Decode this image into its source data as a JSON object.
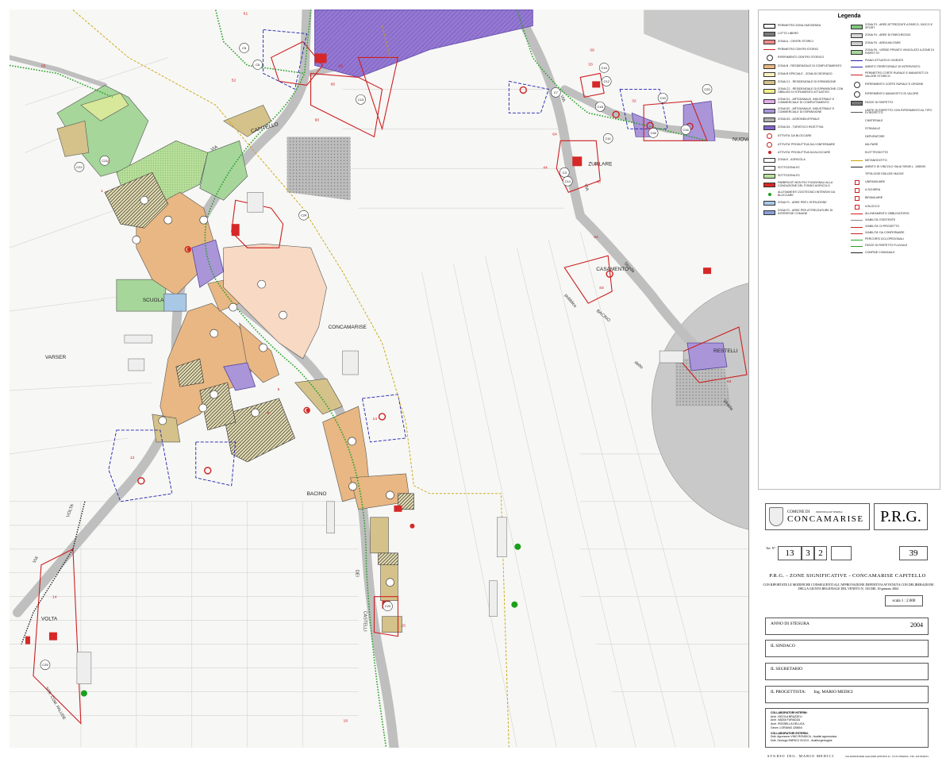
{
  "map": {
    "place_labels": [
      "CAPITELLO",
      "SCUOLA",
      "CONCAMARISE",
      "VARSER",
      "BACINO",
      "VOLTA",
      "ZURLARE",
      "CASAMENTO",
      "NUOVA",
      "RESTELLI"
    ],
    "road_labels": [
      "VIA",
      "VOLTA",
      "VIA",
      "STR. COM. PALUDE",
      "VIA",
      "DEI",
      "CASTELLI",
      "BACINO",
      "Strada",
      "pubblico",
      "detto",
      "Strada",
      "VIA"
    ],
    "zone_numbers": [
      "65",
      "61",
      "52",
      "80",
      "90",
      "85",
      "39",
      "33",
      "32",
      "64",
      "44",
      "65",
      "46",
      "84",
      "83",
      "64",
      "1",
      "2",
      "12",
      "14",
      "14",
      "15",
      "16",
      "5",
      "9"
    ],
    "circle_labels": [
      "C13",
      "C15",
      "C5",
      "C22",
      "C21",
      "C24",
      "C10",
      "C12",
      "C19",
      "C3",
      "C7",
      "C11",
      "C14",
      "C16",
      "C20",
      "C23",
      "C25",
      "C26",
      "C5"
    ],
    "colors": {
      "zone_b": "#e8b783",
      "zone_b_light": "#f7d9c4",
      "zone_c": "#d4c28a",
      "zone_green": "#a6d69a",
      "zone_green_light": "#c8e8b2",
      "zone_yellow_green": "#d7e89a",
      "zone_purple": "#a995d8",
      "zone_purple_dark": "#8266c9",
      "zone_blue": "#a8c8e6",
      "zone_hatch": "#3e3a2a",
      "road_gray": "#c2c2c2",
      "boundary_red": "#cc2020",
      "perimeter_green": "#2aa02a",
      "dotted_yellow": "#c9a400",
      "dashed_blue": "#2020b0"
    }
  },
  "legend": {
    "title": "Legenda",
    "col1": [
      "PERIMETRO ZONA OMOGENEA",
      "LOTTO LIBERO",
      "ZONA A - CENTRI STORICI",
      "PERIMETRO CENTRI STORICI",
      "RIFERIMENTO CENTRO STORICO",
      "ZONA B - RESIDENZIALE DI COMPLETAMENTO",
      "ZONA B SPECIALE - ZONA DI DEGRADO",
      "ZONA C1 - RESIDENZIALE DI ESPANSIONE",
      "ZONA C2 - RESIDENZIALE DI ESPANSIONE CON OBBLIGO DI STRUMENTO ATTUATIVO",
      "ZONA D1 - ARTIGIANALE, INDUSTRIALE E COMMERCIALE DI COMPLETAMENTO",
      "ZONA D2 - ARTIGIANALE, INDUSTRIALE E COMMERCIALE DI ESPANSIONE",
      "ZONA D3 - AGROINDUSTRIALE",
      "ZONA D4 - TURISTICO RICETTIVA",
      "ATTIVITA' DA BLOCCARE",
      "ATTIVITA' PRODUTTIVA DA CONFERMARE",
      "ATTIVITA' PRODUTTIVA DA BLOCCARE",
      "ZONA E - AGRICOLA",
      "SOTTOZONA E2",
      "SOTTOZONA E3",
      "FABBRICATI NON PIU' FUNZIONALI ALLA CONDUZIONE DEL FONDO AGRICOLO",
      "ALLEVAMENTI ZOOTECNICI INTENSIVI DA BLOCCARE",
      "ZONA F1 - AREE PER L'ISTRUZIONE",
      "ZONA F2 - AREE PER ATTREZZATURE DI INTERESSE COMUNE"
    ],
    "col2": [
      "ZONA F3 - AREE ATTREZZATE A PARCO, GIOCO E SPORT",
      "ZONA F4 - AREE DI PARCHEGGIO",
      "ZONA F5 - AREA MILITARE",
      "ZONA F6 - VERDE PRIVATO VINCOLATO A ZONE DI RISPETTO",
      "PIANO ATTUATIVO VIGENTE",
      "AMBITO TERRITORIALE DI INTERVENTO",
      "PERIMETRO CORTE RURALE E MANUFATTI DI VALORE STORICO",
      "RIFERIMENTO CORTE RURALE E ORIGINE",
      "RIFERIMENTO MANUFATTO DI VALORE",
      "FASCE DI RISPETTO",
      "LIMITE DI RISPETTO CON RIFERIMENTO AL TIPO DI RISPETTO",
      "CIMITERIALE",
      "STRADALE",
      "DEPURATORE",
      "MILITARE",
      "ELETTRODOTTO",
      "METANODOTTO",
      "AMBITO DI VINCOLO SIA AI SENSI L. 1089/39",
      "TIPOLOGIE EDILIZIE NUOVE",
      "UNIFAMILIARE",
      "A SCHIERA",
      "BIFAMILIARE",
      "A BLOCCO",
      "ALLINEAMENTO OBBLIGATORIO",
      "VIABILITA' ESISTENTE",
      "VIABILITA' DI PROGETTO",
      "VIABILITA' DA CONFERMARE",
      "PERCORSI CICLOPEDONALI",
      "FASCE DI RISPETTO FLUVIALE",
      "CONFINE COMUNALE"
    ]
  },
  "title_block": {
    "comune_small": "COMUNE DI",
    "provincia": "PROVINCIA DI VERONA",
    "comune_name": "CONCAMARISE",
    "prg": "P.R.G.",
    "tav_label": "Tav. N°",
    "tav_num": "13",
    "tav_a": "3",
    "tav_b": "2",
    "sheet_num": "39",
    "subtitle": "P.R.G. - ZONE SIGNIFICATIVE - CONCAMARISE CAPITELLO",
    "description": "CON RIPORTATE LE MODIFICHE CONSEGUENTI ALL'APPROVAZIONE DEFINITIVA AVVENUTA CON DELIBERAZIONE DELLA GIUNTA REGIONALE DEL VENETO N. 183 DEL 30 gennaio 2004",
    "scala": "scala 1 : 2.000",
    "anno_label": "ANNO DI STESURA",
    "anno_value": "2004",
    "sindaco": "IL SINDACO",
    "segretario": "IL SEGRETARIO",
    "progettista_label": "IL PROGETTISTA:",
    "progettista_value": "Ing. MARIO MEDICI",
    "collab_title_int": "COLLABORATORI INTERNI:",
    "collab_int": [
      "Arch. NICOLA BRAZZELI",
      "Arch. NADIA FURADZA",
      "Arch. ROSSELLA DELUCA",
      "Geom. LORIANO ZANINI"
    ],
    "collab_title_ext": "COLLABORATORI ESTERNI:",
    "collab_ext": [
      "Dott. Agronomo VINO RONDICA - Analisi agronomica",
      "Dott. Geologo ENRICO SCICO - Analisi geologica"
    ],
    "studio": "STUDIO ING. MARIO MEDICI",
    "studio_addr": "VIA MONSIGNOR GIACOMO GENTILE 43 - 37135 VERONA - TEL. 045-8343674"
  }
}
